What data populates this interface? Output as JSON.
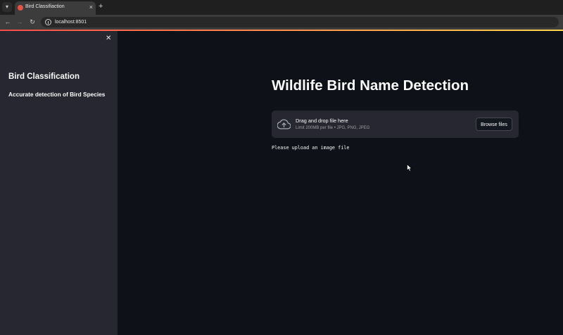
{
  "browser": {
    "tab_title": "Bird Classifiaction",
    "tab_close": "×",
    "new_tab": "+",
    "url": "localhost:8501",
    "nav": {
      "back": "←",
      "forward": "→",
      "reload": "↻"
    }
  },
  "sidebar": {
    "close": "✕",
    "title": "Bird Classification",
    "subtitle": "Accurate detection of Bird Species"
  },
  "main": {
    "title": "Wildlife Bird Name Detection",
    "uploader": {
      "icon": "cloud-upload-icon",
      "title": "Drag and drop file here",
      "hint": "Limit 200MB per file • JPG, PNG, JPEG",
      "button_label": "Browse files"
    },
    "status": "Please upload an image file"
  },
  "colors": {
    "background": "#0e1117",
    "sidebar": "#262730",
    "accent": "#ff4b4b",
    "text": "#fafafa"
  }
}
